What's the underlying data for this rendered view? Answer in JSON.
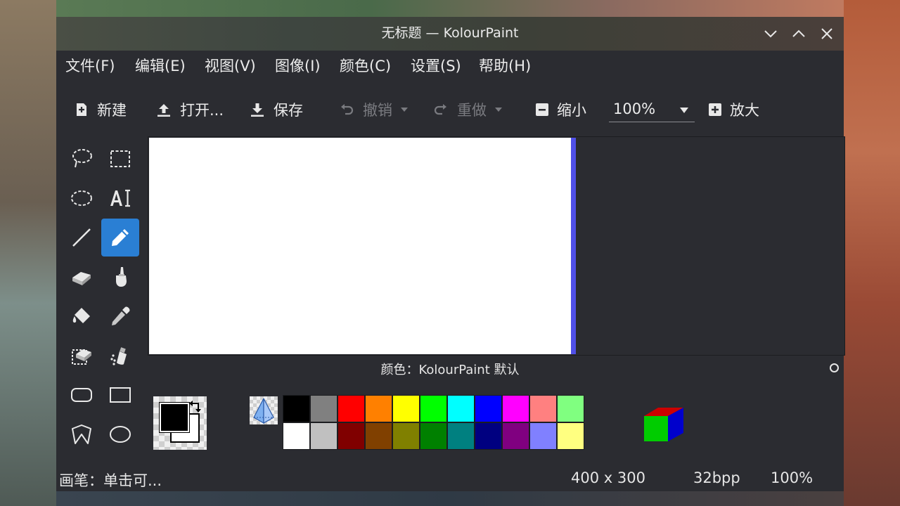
{
  "window": {
    "title": "无标题 — KolourPaint"
  },
  "menu": [
    "文件(F)",
    "编辑(E)",
    "视图(V)",
    "图像(I)",
    "颜色(C)",
    "设置(S)",
    "帮助(H)"
  ],
  "toolbar": {
    "new_label": "新建",
    "open_label": "打开...",
    "save_label": "保存",
    "undo_label": "撤销",
    "redo_label": "重做",
    "zoom_out_label": "缩小",
    "zoom_value": "100%",
    "zoom_in_label": "放大"
  },
  "tools": [
    {
      "name": "free-form-selection",
      "icon": "lasso-icon"
    },
    {
      "name": "rectangular-selection",
      "icon": "rect-select-icon"
    },
    {
      "name": "elliptical-selection",
      "icon": "ellipse-select-icon"
    },
    {
      "name": "text",
      "icon": "text-icon"
    },
    {
      "name": "line",
      "icon": "line-icon"
    },
    {
      "name": "pen",
      "icon": "pen-icon",
      "active": true
    },
    {
      "name": "eraser",
      "icon": "eraser-icon"
    },
    {
      "name": "brush",
      "icon": "brush-icon"
    },
    {
      "name": "flood-fill",
      "icon": "fill-icon"
    },
    {
      "name": "color-picker",
      "icon": "eyedropper-icon"
    },
    {
      "name": "color-eraser",
      "icon": "color-eraser-icon"
    },
    {
      "name": "spraycan",
      "icon": "spraycan-icon"
    },
    {
      "name": "rounded-rectangle",
      "icon": "rounded-rect-icon"
    },
    {
      "name": "rectangle",
      "icon": "rect-icon"
    },
    {
      "name": "polygon",
      "icon": "polygon-icon"
    },
    {
      "name": "ellipse",
      "icon": "ellipse-icon"
    }
  ],
  "palette": {
    "label": "颜色：KolourPaint 默认",
    "colors_top": [
      "#000000",
      "#808080",
      "#ff0000",
      "#ff8000",
      "#ffff00",
      "#00ff00",
      "#00ffff",
      "#0000ff",
      "#ff00ff",
      "#ff8080",
      "#80ff80"
    ],
    "colors_bottom": [
      "#ffffff",
      "#c0c0c0",
      "#800000",
      "#804000",
      "#808000",
      "#008000",
      "#008080",
      "#000080",
      "#800080",
      "#8080ff",
      "#ffff80"
    ],
    "foreground": "#000000",
    "background": "#ffffff"
  },
  "status": {
    "message": "画笔：单击可...",
    "image_size": "400 x 300",
    "depth": "32bpp",
    "zoom": "100%"
  }
}
